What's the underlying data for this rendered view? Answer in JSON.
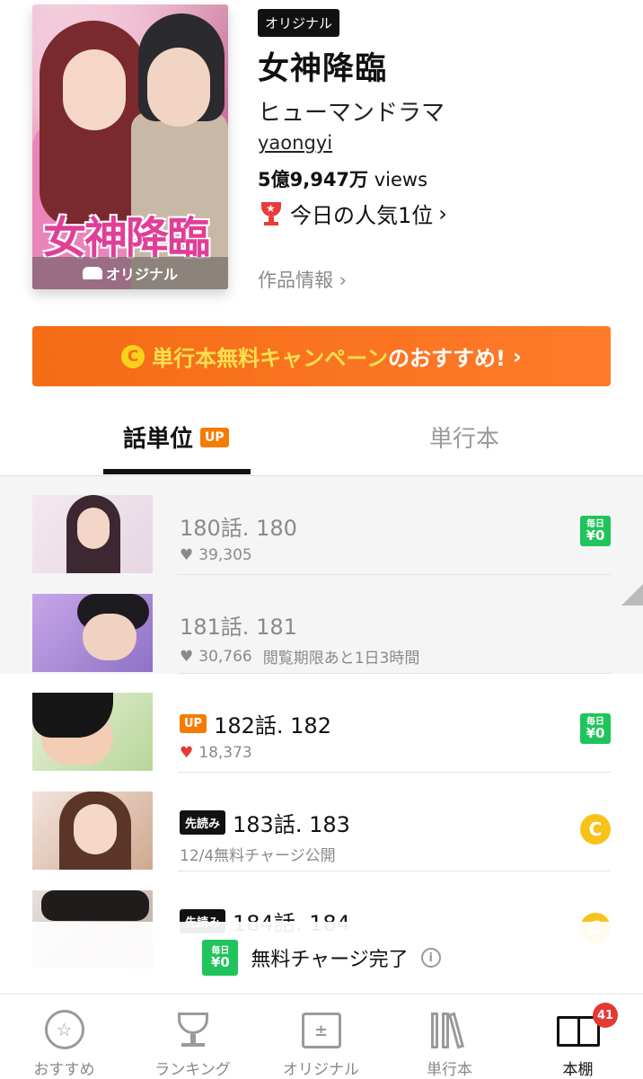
{
  "header": {
    "cover_title": "女神降臨",
    "cover_band": "オリジナル",
    "badge": "オリジナル",
    "title": "女神降臨",
    "genre": "ヒューマンドラマ",
    "author": "yaongyi",
    "views_number": "5億9,947万",
    "views_unit": "views",
    "rank_text": "今日の人気1位",
    "rank_chevron": "›",
    "info_link": "作品情報 ›"
  },
  "campaign": {
    "icon": "C",
    "text_pre": "単行本無料キャンペーン",
    "text_post": "のおすすめ!",
    "chevron": "›",
    "colors": {
      "bg": "#f56c16",
      "highlight": "#f9e04f"
    }
  },
  "tabs": {
    "active": "話単位",
    "active_badge": "UP",
    "inactive": "単行本"
  },
  "episodes": [
    {
      "title": "180話. 180",
      "likes": "39,305",
      "note": "",
      "tag": "",
      "right": "free",
      "read": true
    },
    {
      "title": "181話. 181",
      "likes": "30,766",
      "note": "閲覧期限あと1日3時間",
      "tag": "",
      "right": "",
      "read": true
    },
    {
      "title": "182話. 182",
      "likes": "18,373",
      "note": "",
      "tag": "UP",
      "right": "free",
      "read": false
    },
    {
      "title": "183話. 183",
      "likes": "",
      "note": "12/4無料チャージ公開",
      "tag": "先読み",
      "right": "coin",
      "read": false
    },
    {
      "title": "184話. 184",
      "likes": "",
      "note": "",
      "tag": "先読み",
      "right": "coin",
      "read": false
    }
  ],
  "free_badge": {
    "top": "毎日",
    "bottom": "¥0"
  },
  "coin_label": "C",
  "toast": {
    "text": "無料チャージ完了",
    "info": "i"
  },
  "nav": {
    "items": [
      "おすすめ",
      "ランキング",
      "オリジナル",
      "単行本",
      "本棚"
    ],
    "badge_count": "41",
    "calendar_glyph": "±"
  }
}
